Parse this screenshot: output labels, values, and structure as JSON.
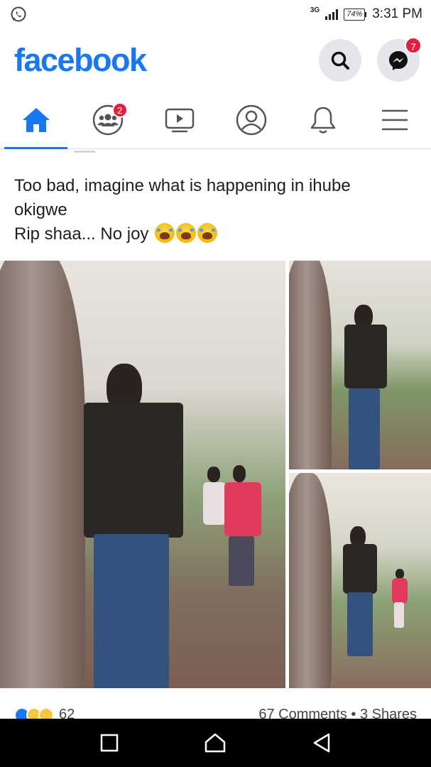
{
  "status_bar": {
    "app_icon": "whatsapp-icon",
    "network": "3G",
    "battery": "74%",
    "time": "3:31 PM"
  },
  "header": {
    "logo": "facebook",
    "search_icon": "search-icon",
    "messenger_icon": "messenger-icon",
    "messenger_badge": "7"
  },
  "nav": {
    "tabs": [
      {
        "icon": "home-icon",
        "active": true
      },
      {
        "icon": "groups-icon",
        "badge": "2"
      },
      {
        "icon": "watch-icon"
      },
      {
        "icon": "profile-icon"
      },
      {
        "icon": "bell-icon"
      },
      {
        "icon": "menu-icon"
      }
    ]
  },
  "post": {
    "text_line1": "Too bad, imagine what is happening in ihube",
    "text_line2": "okigwe",
    "text_line3": "Rip shaa... No joy",
    "emoji_icon": "loudly-crying-face-icon",
    "reactions": [
      "like",
      "sad",
      "haha"
    ],
    "reaction_count": "62",
    "comments_shares": "67 Comments • 3 Shares"
  },
  "android_nav": [
    "recent-apps-icon",
    "home-circle-icon",
    "back-icon"
  ],
  "colors": {
    "brand": "#1877f2",
    "badge": "#e41e3f",
    "text": "#1c1e21"
  }
}
